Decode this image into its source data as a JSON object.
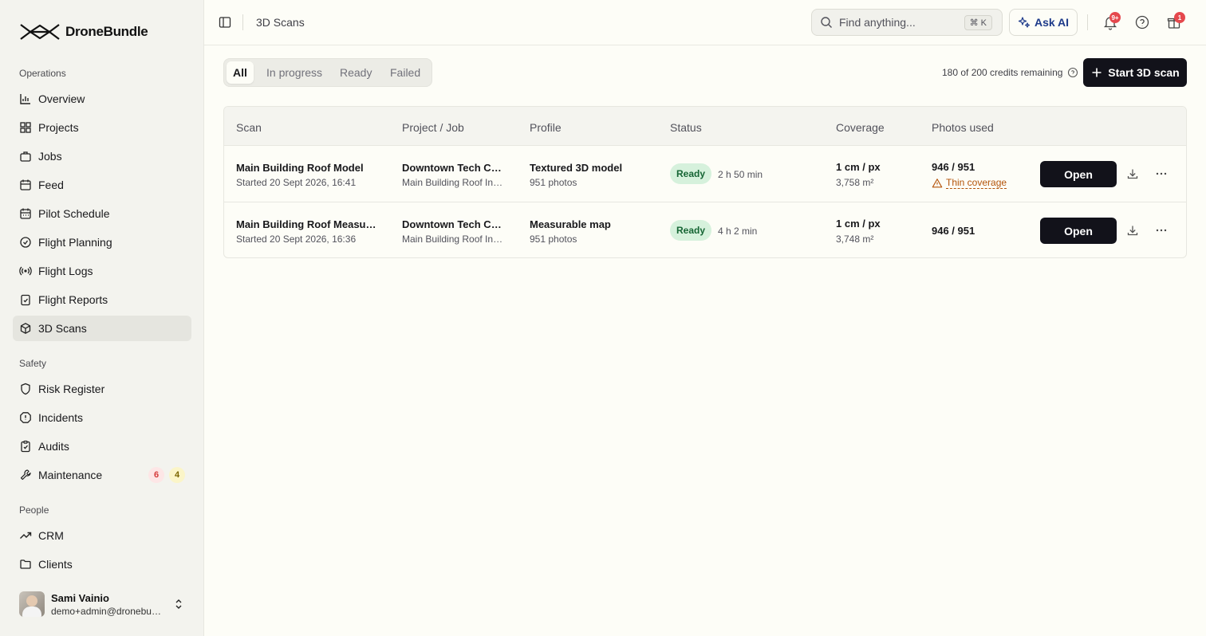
{
  "brand": {
    "name": "DroneBundle"
  },
  "sidebar": {
    "sections": [
      {
        "label": "Operations",
        "items": [
          {
            "label": "Overview",
            "icon": "chart-icon"
          },
          {
            "label": "Projects",
            "icon": "grid-icon"
          },
          {
            "label": "Jobs",
            "icon": "briefcase-icon"
          },
          {
            "label": "Feed",
            "icon": "calendar-icon"
          },
          {
            "label": "Pilot Schedule",
            "icon": "calendar-days-icon"
          },
          {
            "label": "Flight Planning",
            "icon": "check-circle-icon"
          },
          {
            "label": "Flight Logs",
            "icon": "radio-icon"
          },
          {
            "label": "Flight Reports",
            "icon": "clipboard-check-icon"
          },
          {
            "label": "3D Scans",
            "icon": "box-icon",
            "active": true
          }
        ]
      },
      {
        "label": "Safety",
        "items": [
          {
            "label": "Risk Register",
            "icon": "shield-icon"
          },
          {
            "label": "Incidents",
            "icon": "alert-octagon-icon"
          },
          {
            "label": "Audits",
            "icon": "clipboard-icon"
          },
          {
            "label": "Maintenance",
            "icon": "wrench-icon",
            "badges": [
              "6",
              "4"
            ]
          }
        ]
      },
      {
        "label": "People",
        "items": [
          {
            "label": "CRM",
            "icon": "trending-icon"
          },
          {
            "label": "Clients",
            "icon": "folder-icon"
          }
        ]
      }
    ],
    "user": {
      "name": "Sami Vainio",
      "email": "demo+admin@dronebundle.com"
    }
  },
  "topbar": {
    "breadcrumb": "3D Scans",
    "search_placeholder": "Find anything...",
    "search_shortcut": "⌘ K",
    "ask_ai_label": "Ask AI",
    "notifications_badge": "9+",
    "gifts_badge": "1"
  },
  "toolbar": {
    "tabs": [
      "All",
      "In progress",
      "Ready",
      "Failed"
    ],
    "active_tab": "All",
    "credits_text": "180 of 200 credits remaining",
    "start_label": "Start 3D scan"
  },
  "table": {
    "columns": [
      "Scan",
      "Project / Job",
      "Profile",
      "Status",
      "Coverage",
      "Photos used"
    ],
    "rows": [
      {
        "scan": "Main Building Roof Model",
        "started": "Started 20 Sept 2026, 16:41",
        "project": "Downtown Tech Campus",
        "job": "Main Building Roof Inspection",
        "profile": "Textured 3D model",
        "photos": "951 photos",
        "status": "Ready",
        "duration": "2 h 50 min",
        "coverage": "1 cm / px",
        "area": "3,758 m²",
        "photos_used": "946 / 951",
        "warning": "Thin coverage",
        "open_label": "Open"
      },
      {
        "scan": "Main Building Roof Measurement",
        "started": "Started 20 Sept 2026, 16:36",
        "project": "Downtown Tech Campus",
        "job": "Main Building Roof Inspection",
        "profile": "Measurable map",
        "photos": "951 photos",
        "status": "Ready",
        "duration": "4 h 2 min",
        "coverage": "1 cm / px",
        "area": "3,748 m²",
        "photos_used": "946 / 951",
        "open_label": "Open"
      }
    ]
  }
}
